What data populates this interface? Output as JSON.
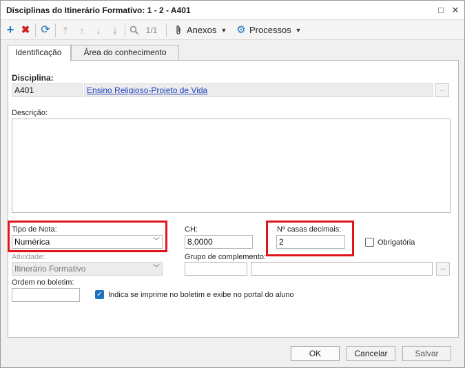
{
  "window": {
    "title": "Disciplinas do Itinerário Formativo: 1 - 2 - A401",
    "restore_glyph": "□",
    "close_glyph": "✕"
  },
  "toolbar": {
    "page_indicator": "1/1",
    "anexos_label": "Anexos",
    "processos_label": "Processos",
    "icons": [
      "add-icon",
      "delete-icon",
      "refresh-icon",
      "first-icon",
      "previous-icon",
      "next-icon",
      "last-icon",
      "search-icon",
      "paperclip-icon",
      "gear-icon"
    ],
    "colors": {
      "add": "#1e73be",
      "delete": "#cc2222",
      "refresh": "#1e73be",
      "nav_disabled": "#a9a9a9"
    }
  },
  "tabs": [
    {
      "label": "Identificação",
      "active": true
    },
    {
      "label": "Área do conhecimento",
      "active": false
    }
  ],
  "form": {
    "disciplina_label": "Disciplina:",
    "disciplina_code": "A401",
    "disciplina_name": "Ensino Religioso-Projeto de Vida",
    "lookup_glyph": "...",
    "descricao_label": "Descrição:",
    "descricao_value": "",
    "tipo_nota_label": "Tipo de Nota:",
    "tipo_nota_value": "Numérica",
    "ch_label": "CH:",
    "ch_value": "8,0000",
    "casas_decimais_label": "Nº casas decimais:",
    "casas_decimais_value": "2",
    "obrigatoria_label": "Obrigatória",
    "obrigatoria_checked": false,
    "atividade_label": "Atividade:",
    "atividade_value": "Itinerário Formativo",
    "grupo_label": "Grupo de complemento:",
    "grupo_code": "",
    "grupo_name": "",
    "ordem_label": "Ordem no boletim:",
    "ordem_value": "",
    "imprime_label": "Indica se imprime no boletim e exibe no portal do aluno",
    "imprime_checked": true,
    "highlight_color": "#e0141a"
  },
  "footer": {
    "ok_label": "OK",
    "cancel_label": "Cancelar",
    "save_label": "Salvar"
  }
}
